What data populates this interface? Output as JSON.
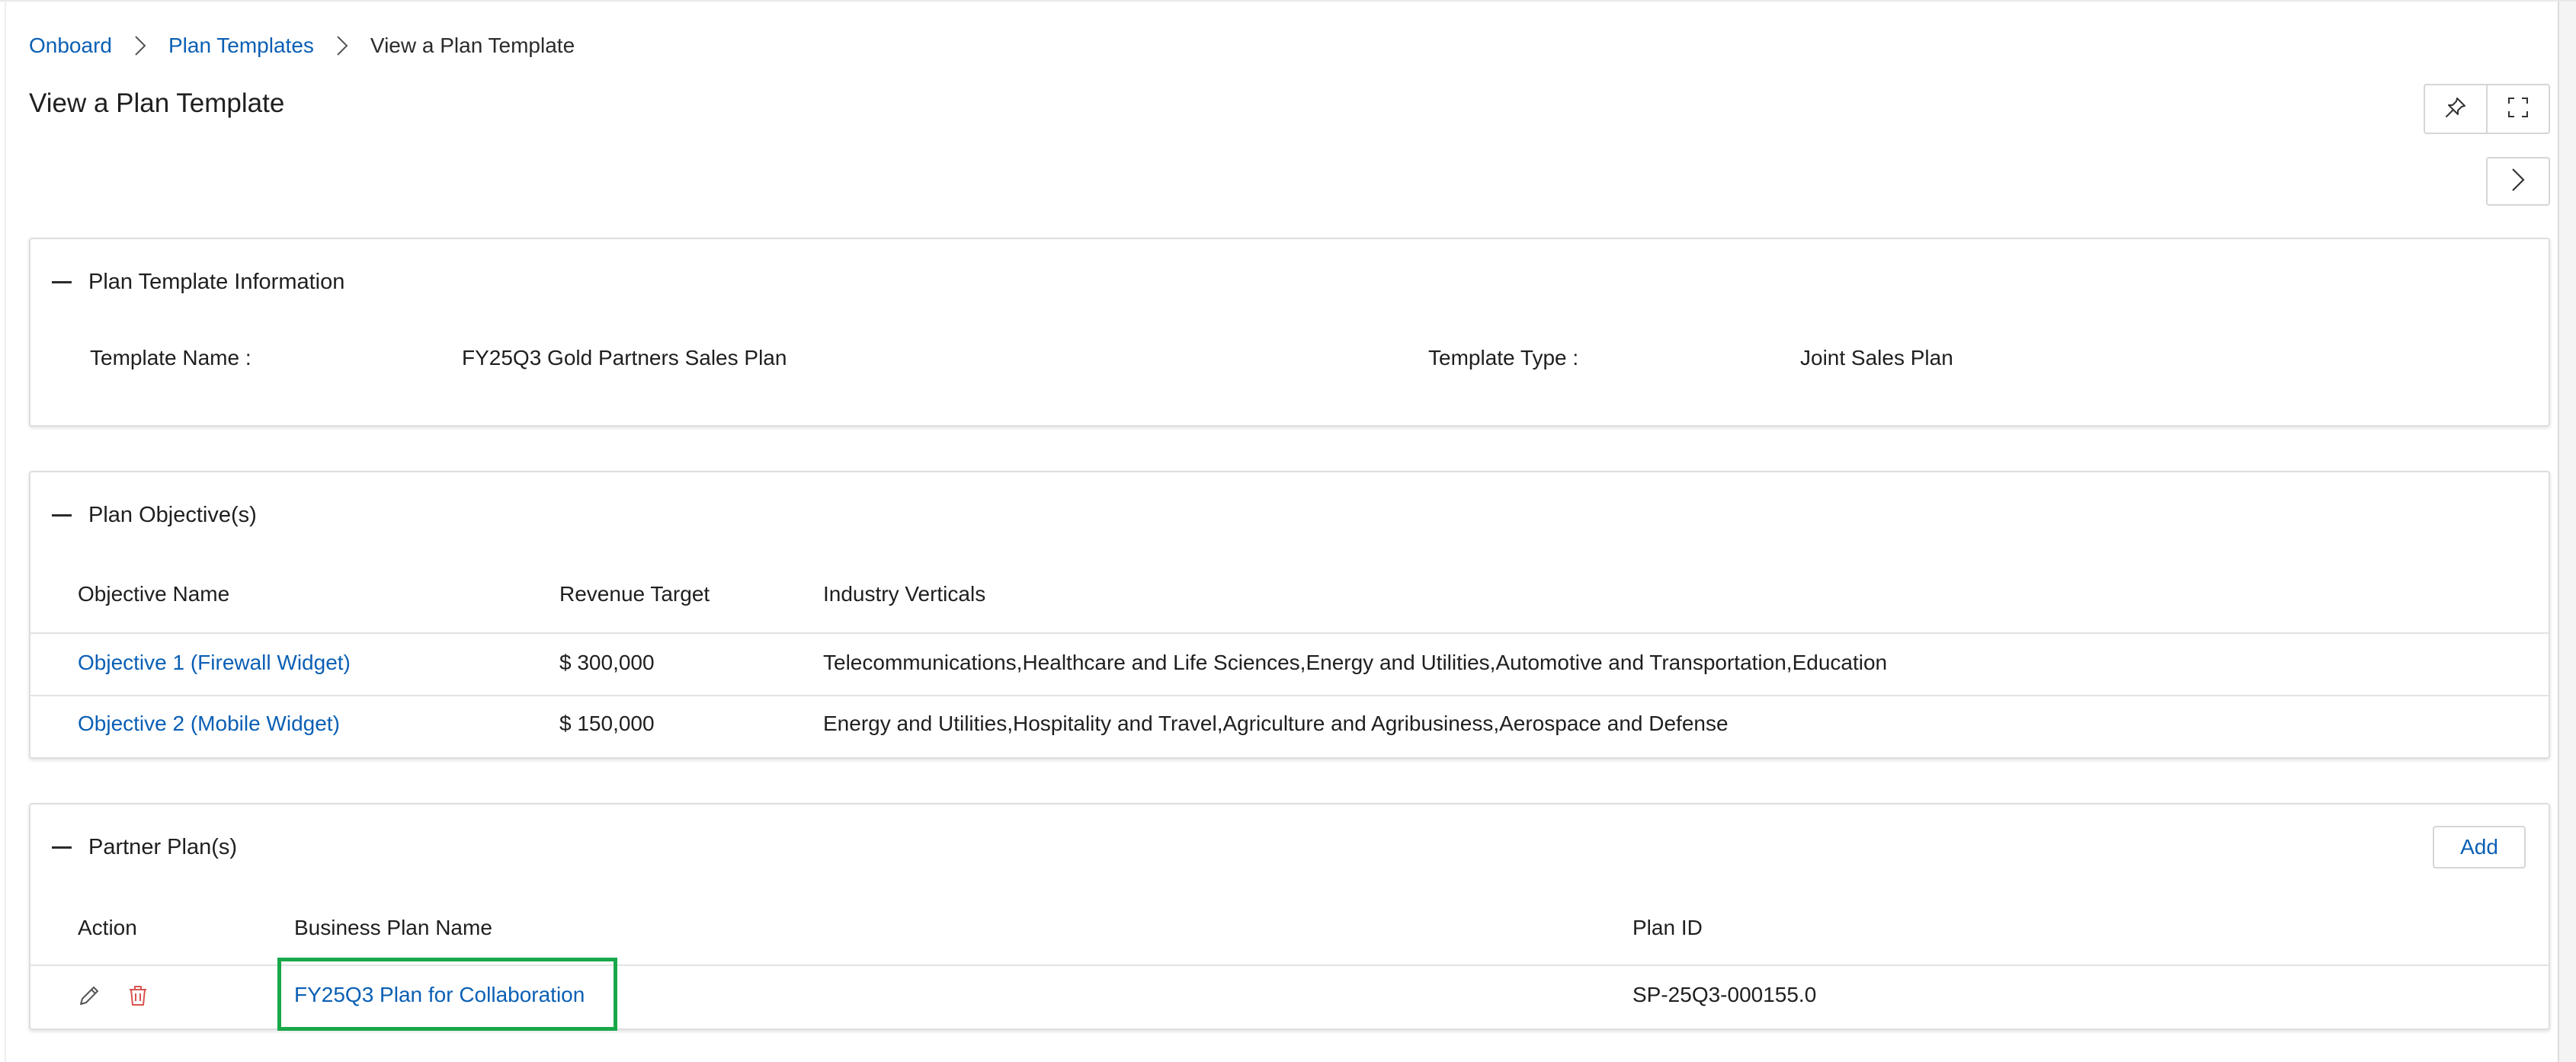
{
  "breadcrumb": {
    "items": [
      "Onboard",
      "Plan Templates"
    ],
    "current": "View a Plan Template"
  },
  "page": {
    "title": "View a Plan Template"
  },
  "toolbar": {
    "pin_icon": "pin-icon",
    "fullscreen_icon": "fullscreen-icon",
    "next_icon": "chevron-right-icon"
  },
  "info_panel": {
    "title": "Plan Template Information",
    "template_name_label": "Template Name :",
    "template_name_value": "FY25Q3 Gold Partners Sales Plan",
    "template_type_label": "Template Type :",
    "template_type_value": "Joint Sales Plan"
  },
  "objectives_panel": {
    "title": "Plan Objective(s)",
    "columns": [
      "Objective Name",
      "Revenue Target",
      "Industry Verticals"
    ],
    "rows": [
      {
        "name": "Objective 1 (Firewall Widget)",
        "revenue": "$ 300,000",
        "verticals": "Telecommunications,Healthcare and Life Sciences,Energy and Utilities,Automotive and Transportation,Education"
      },
      {
        "name": "Objective 2 (Mobile Widget)",
        "revenue": "$ 150,000",
        "verticals": "Energy and Utilities,Hospitality and Travel,Agriculture and Agribusiness,Aerospace and Defense"
      }
    ]
  },
  "partner_panel": {
    "title": "Partner Plan(s)",
    "add_label": "Add",
    "columns": [
      "Action",
      "Business Plan Name",
      "Plan ID"
    ],
    "rows": [
      {
        "plan_name": "FY25Q3 Plan for Collaboration",
        "plan_id": "SP-25Q3-000155.0"
      }
    ]
  },
  "colors": {
    "link": "#0a5fb4",
    "delete": "#d9534f",
    "highlight": "#18a84a"
  }
}
